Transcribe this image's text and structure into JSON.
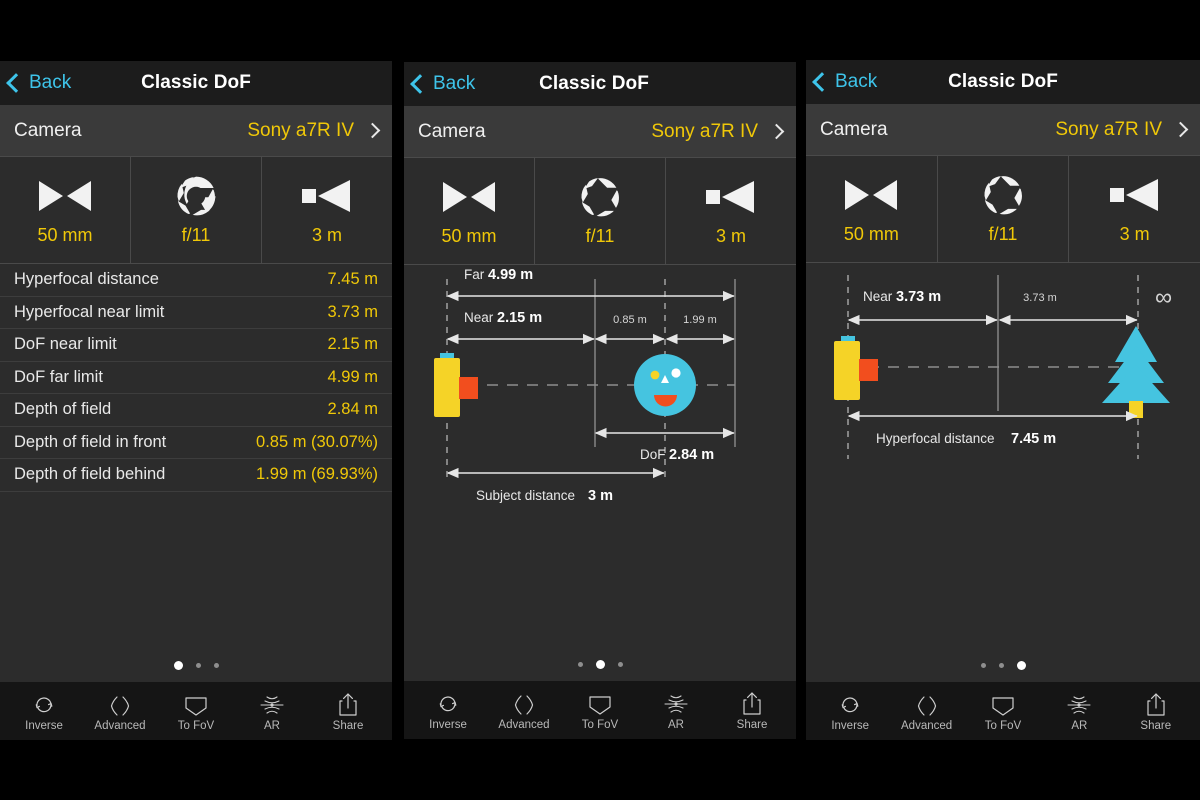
{
  "app": {
    "nav": {
      "back_label": "Back",
      "title": "Classic DoF",
      "back_icon": "chevron-left-icon"
    },
    "camera_row": {
      "label": "Camera",
      "value": "Sony a7R IV",
      "disclosure_icon": "chevron-right-icon"
    },
    "tiles": [
      {
        "icon": "focal-length-icon",
        "value": "50 mm"
      },
      {
        "icon": "aperture-icon",
        "value": "f/11"
      },
      {
        "icon": "subject-distance-icon",
        "value": "3 m"
      }
    ],
    "toolbar": [
      {
        "icon": "inverse-icon",
        "label": "Inverse"
      },
      {
        "icon": "advanced-icon",
        "label": "Advanced"
      },
      {
        "icon": "to-fov-icon",
        "label": "To FoV"
      },
      {
        "icon": "ar-icon",
        "label": "AR"
      },
      {
        "icon": "share-icon",
        "label": "Share"
      }
    ],
    "colors": {
      "accent_yellow": "#f0c808",
      "link_blue": "#3ec4ea",
      "figure_cyan": "#45c4e0",
      "figure_orange": "#f24e1e",
      "panel_bg": "#2c2c2c",
      "navbar_bg": "#1c1c1c",
      "toolbar_bg": "#151515"
    }
  },
  "panels": [
    {
      "page_index": 0,
      "dots": [
        true,
        false,
        false
      ]
    },
    {
      "page_index": 1,
      "dots": [
        false,
        true,
        false
      ]
    },
    {
      "page_index": 2,
      "dots": [
        false,
        false,
        true
      ]
    }
  ],
  "results": {
    "rows": [
      {
        "label": "Hyperfocal distance",
        "value": "7.45 m"
      },
      {
        "label": "Hyperfocal near limit",
        "value": "3.73 m"
      },
      {
        "label": "DoF near limit",
        "value": "2.15 m"
      },
      {
        "label": "DoF far limit",
        "value": "4.99 m"
      },
      {
        "label": "Depth of field",
        "value": "2.84 m"
      },
      {
        "label": "Depth of field in front",
        "value": "0.85 m (30.07%)"
      },
      {
        "label": "Depth of field behind",
        "value": "1.99 m (69.93%)"
      }
    ]
  },
  "diagram_dof": {
    "subject_icon": "smiley-face-icon",
    "camera_icon": "camera-icon",
    "labels": {
      "far_prefix": "Far",
      "far_value": "4.99 m",
      "near_prefix": "Near",
      "near_value": "2.15 m",
      "front_value": "0.85 m",
      "behind_value": "1.99 m",
      "dof_prefix": "DoF",
      "dof_value": "2.84 m",
      "subject_prefix": "Subject distance",
      "subject_value": "3 m"
    }
  },
  "diagram_hyperfocal": {
    "subject_icon": "tree-icon",
    "camera_icon": "camera-icon",
    "infinity_glyph": "∞",
    "labels": {
      "near_prefix": "Near",
      "near_value": "3.73 m",
      "far_value": "3.73 m",
      "hyperfocal_prefix": "Hyperfocal distance",
      "hyperfocal_value": "7.45 m"
    }
  }
}
